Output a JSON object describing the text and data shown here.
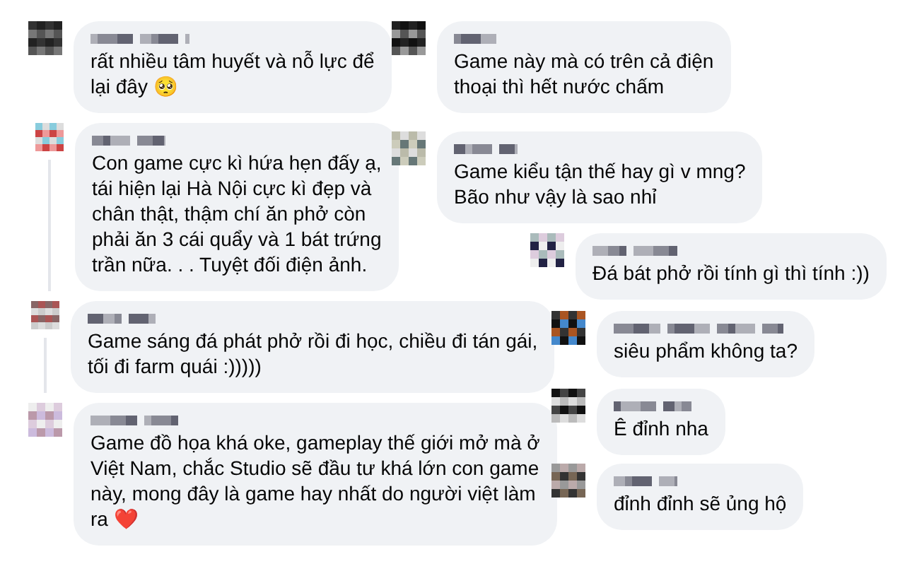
{
  "comments": [
    {
      "kind": "comment",
      "lines": [
        "rất nhiều tâm huyết và nỗ lực để",
        "lại đây 🥺"
      ]
    },
    {
      "kind": "reply",
      "lines": [
        "Con game cực kì hứa hẹn đấy ạ,",
        "tái hiện lại Hà Nội cực kì đẹp và",
        "chân thật, thậm chí ăn phở còn",
        "phải ăn 3 cái quẩy và 1 bát trứng",
        "trần nữa. . . Tuyệt đối điện ảnh."
      ]
    },
    {
      "kind": "reply",
      "lines": [
        "Game sáng đá phát phở rồi đi học, chiều đi tán gái,",
        "tối đi farm quái :)))))"
      ]
    },
    {
      "kind": "comment",
      "lines": [
        "Game đồ họa khá oke, gameplay thế giới mở mà ở",
        "Việt Nam, chắc Studio sẽ đầu tư khá lớn con game",
        "này, mong đây là game hay nhất do người việt làm",
        "ra ❤️"
      ]
    },
    {
      "kind": "comment",
      "lines": [
        "Game này mà có trên cả điện",
        "thoại thì hết nước chấm"
      ]
    },
    {
      "kind": "comment",
      "lines": [
        "Game kiểu tận thế hay gì v mng?",
        "Bão như vậy là sao nhỉ"
      ]
    },
    {
      "kind": "comment",
      "lines": [
        "Đá bát phở rồi tính gì thì tính :))"
      ]
    },
    {
      "kind": "comment",
      "lines": [
        "siêu phẩm không ta?"
      ]
    },
    {
      "kind": "comment",
      "lines": [
        "Ê đỉnh nha"
      ]
    },
    {
      "kind": "comment",
      "lines": [
        "đỉnh đỉnh sẽ ủng hộ"
      ]
    }
  ]
}
